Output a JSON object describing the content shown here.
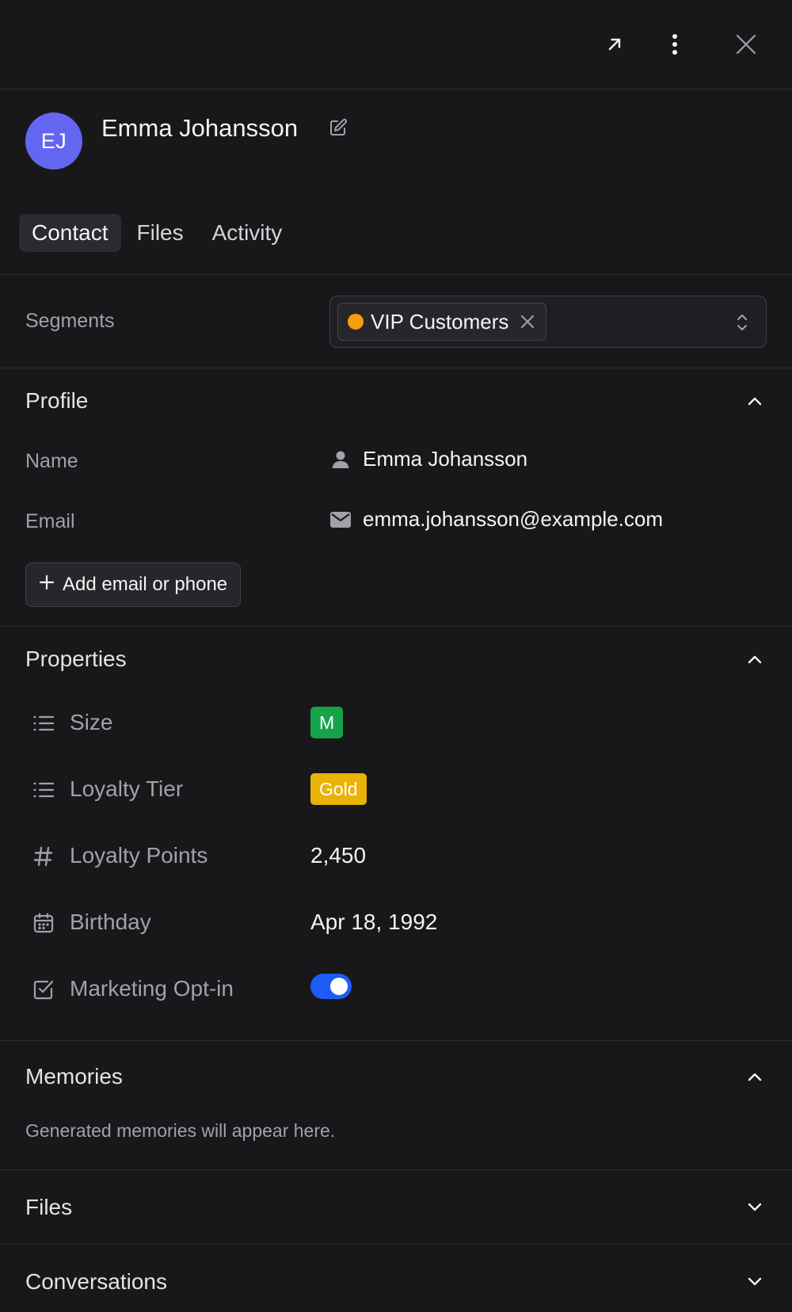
{
  "topbar": {
    "open_icon": "arrow-up-right-icon",
    "more_icon": "more-vertical-icon",
    "close_icon": "close-icon"
  },
  "contact": {
    "initials": "EJ",
    "name": "Emma Johansson",
    "avatar_color": "#6366f1",
    "edit_icon": "edit-icon"
  },
  "tabs": [
    {
      "label": "Contact",
      "active": true
    },
    {
      "label": "Files",
      "active": false
    },
    {
      "label": "Activity",
      "active": false
    }
  ],
  "segments": {
    "label": "Segments",
    "selected": [
      {
        "label": "VIP Customers",
        "color": "#f59e0b"
      }
    ]
  },
  "profile": {
    "title": "Profile",
    "fields": [
      {
        "label": "Name",
        "value": "Emma Johansson",
        "icon": "person-icon"
      },
      {
        "label": "Email",
        "value": "emma.johansson@example.com",
        "icon": "mail-icon"
      }
    ],
    "add_button": "Add email or phone"
  },
  "properties": {
    "title": "Properties",
    "items": [
      {
        "label": "Size",
        "icon": "list-icon",
        "value": "M",
        "type": "badge",
        "color": "#16a34a"
      },
      {
        "label": "Loyalty Tier",
        "icon": "list-icon",
        "value": "Gold",
        "type": "badge",
        "color": "#eab308"
      },
      {
        "label": "Loyalty Points",
        "icon": "hash-icon",
        "value": "2,450",
        "type": "text"
      },
      {
        "label": "Birthday",
        "icon": "calendar-icon",
        "value": "Apr 18, 1992",
        "type": "text"
      },
      {
        "label": "Marketing Opt-in",
        "icon": "checkbox-icon",
        "value": true,
        "type": "toggle",
        "color": "#1d5cf5"
      }
    ]
  },
  "memories": {
    "title": "Memories",
    "empty_text": "Generated memories will appear here."
  },
  "files_section": {
    "title": "Files"
  },
  "conversations_section": {
    "title": "Conversations"
  }
}
